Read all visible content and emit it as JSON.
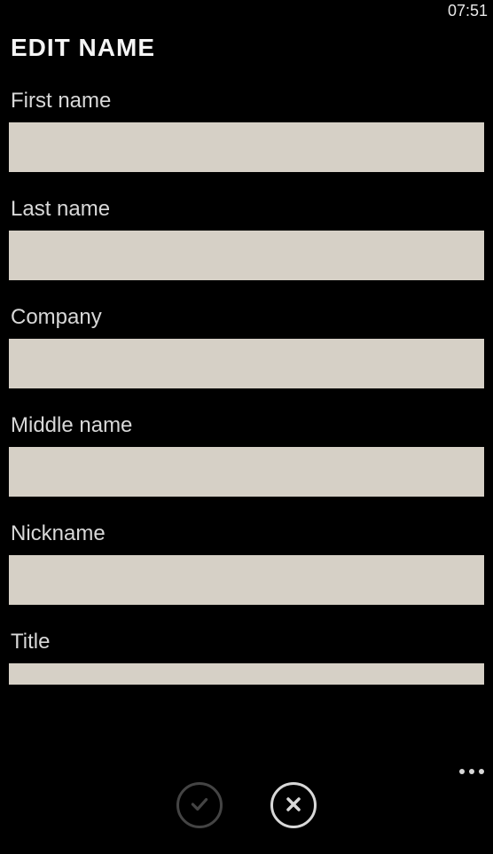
{
  "status": {
    "time": "07:51"
  },
  "page": {
    "title": "EDIT NAME"
  },
  "fields": {
    "first_name": {
      "label": "First name",
      "value": ""
    },
    "last_name": {
      "label": "Last name",
      "value": ""
    },
    "company": {
      "label": "Company",
      "value": ""
    },
    "middle_name": {
      "label": "Middle name",
      "value": ""
    },
    "nickname": {
      "label": "Nickname",
      "value": ""
    },
    "title": {
      "label": "Title",
      "value": ""
    }
  }
}
